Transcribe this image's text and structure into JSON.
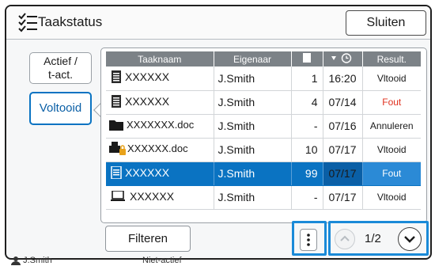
{
  "window": {
    "title": "Taakstatus",
    "close_label": "Sluiten"
  },
  "sidebar": {
    "items": [
      {
        "label_line1": "Actief /",
        "label_line2": "t-act.",
        "selected": false
      },
      {
        "label": "Voltooid",
        "selected": true
      }
    ]
  },
  "table": {
    "headers": [
      "Taaknaam",
      "Eigenaar",
      "",
      "",
      "Result."
    ],
    "header_icons": {
      "pages": "document-icon",
      "time": "clock-sort-icon"
    },
    "rows": [
      {
        "icon": "print-document-icon",
        "name": "XXXXXX",
        "owner": "J.Smith",
        "pages": "1",
        "time": "16:20",
        "result": "Vltooid",
        "selected": false
      },
      {
        "icon": "print-document-icon",
        "name": "XXXXXX",
        "owner": "J.Smith",
        "pages": "4",
        "time": "07/14",
        "result": "Fout",
        "selected": false
      },
      {
        "icon": "folder-icon",
        "name": "XXXXXXX.doc",
        "owner": "J.Smith",
        "pages": "-",
        "time": "07/16",
        "result": "Annuleren",
        "selected": false
      },
      {
        "icon": "locked-print-icon",
        "name": "XXXXXX.doc",
        "owner": "J.Smith",
        "pages": "10",
        "time": "07/17",
        "result": "Vltooid",
        "selected": false
      },
      {
        "icon": "print-document-icon",
        "name": "XXXXXX",
        "owner": "J.Smith",
        "pages": "99",
        "time": "07/17",
        "result": "Fout",
        "selected": true
      },
      {
        "icon": "computer-icon",
        "name": "XXXXXX",
        "owner": "J.Smith",
        "pages": "-",
        "time": "07/17",
        "result": "Vltooid",
        "selected": false
      }
    ]
  },
  "footer": {
    "filter_label": "Filteren",
    "page_indicator": "1/2"
  },
  "statusbar": {
    "user": "J.Smith",
    "state": "Niet-actief"
  },
  "colors": {
    "accent": "#0a73c2",
    "header": "#7c8287",
    "error": "#e0301e",
    "highlight": "#1a8ad8"
  }
}
